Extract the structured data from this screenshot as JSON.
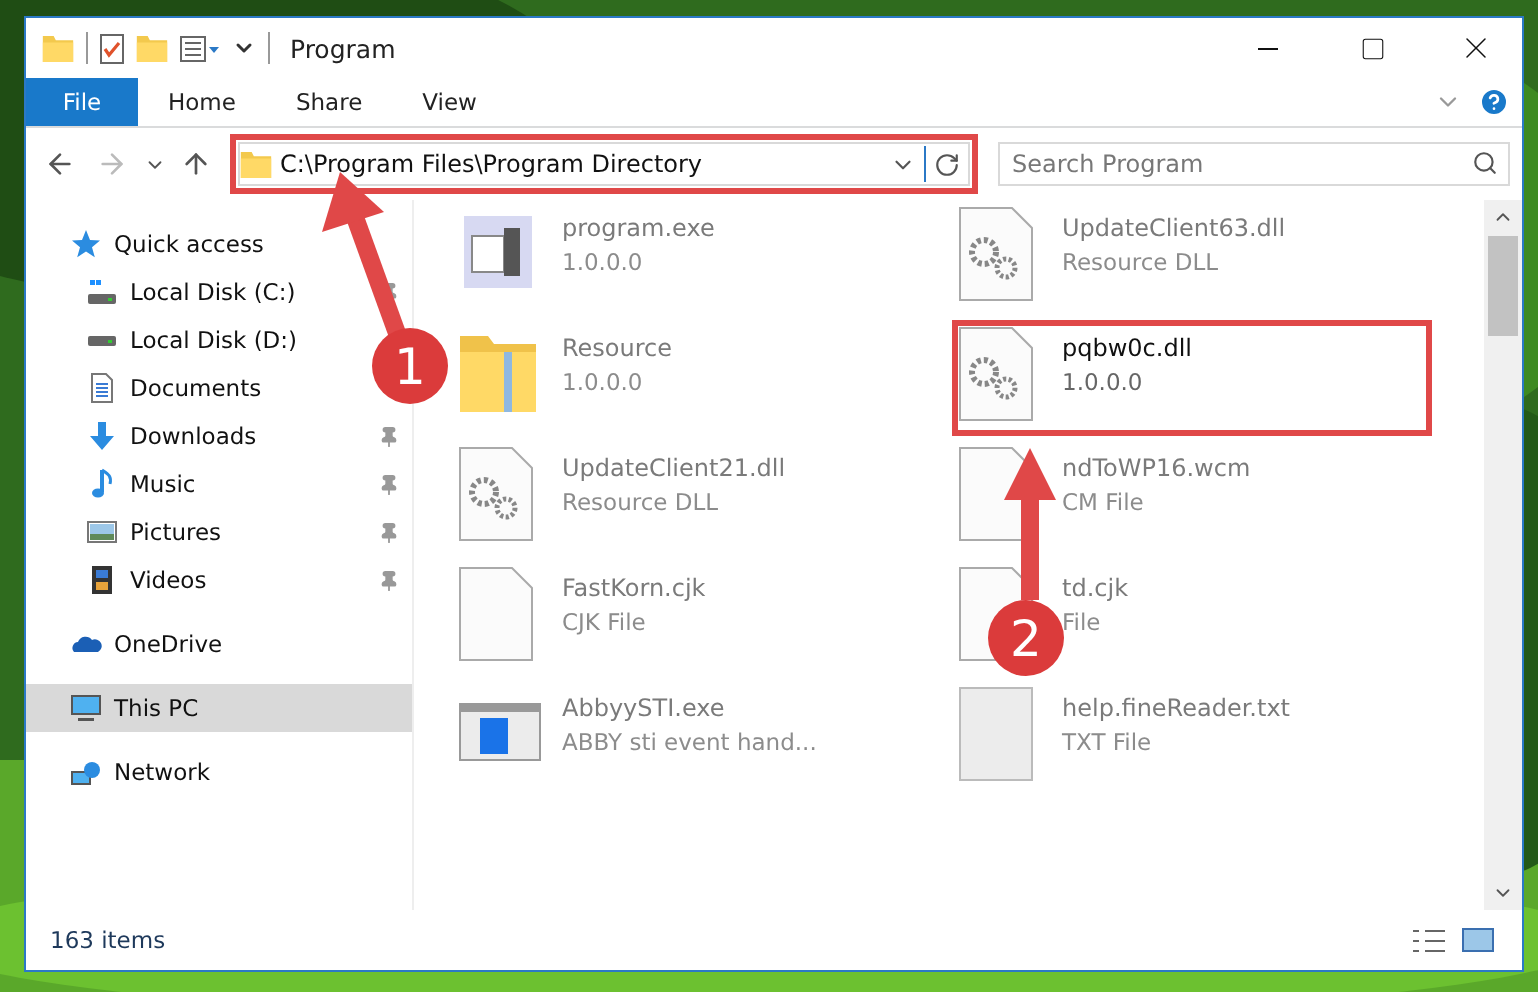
{
  "window": {
    "title": "Program"
  },
  "ribbon_tabs": [
    {
      "label": "File",
      "kind": "menu"
    },
    {
      "label": "Home",
      "kind": "tab"
    },
    {
      "label": "Share",
      "kind": "tab"
    },
    {
      "label": "View",
      "kind": "tab"
    }
  ],
  "address_bar": {
    "path": "C:\\Program Files\\Program Directory",
    "highlighted": true
  },
  "search": {
    "placeholder": "Search Program"
  },
  "sidebar": {
    "items": [
      {
        "label": "Quick access",
        "kind": "star",
        "selected": false,
        "children": [
          {
            "label": "Local Disk (C:)",
            "kind": "system",
            "selected": false,
            "pinned": true
          },
          {
            "label": "Local Disk (D:)",
            "kind": "drive",
            "selected": false,
            "pinned": false
          },
          {
            "label": "Documents",
            "kind": "document",
            "selected": false,
            "pinned": false
          },
          {
            "label": "Downloads",
            "kind": "download",
            "selected": false,
            "pinned": true
          },
          {
            "label": "Music",
            "kind": "music",
            "selected": false,
            "pinned": true
          },
          {
            "label": "Pictures",
            "kind": "pictures",
            "selected": false,
            "pinned": true
          },
          {
            "label": "Videos",
            "kind": "videos",
            "selected": false,
            "pinned": true
          }
        ]
      },
      {
        "label": "OneDrive",
        "kind": "cloud",
        "selected": false
      },
      {
        "label": "This PC",
        "kind": "computer",
        "selected": true
      },
      {
        "label": "Network",
        "kind": "network",
        "selected": false
      }
    ]
  },
  "files": [
    {
      "name": "program.exe",
      "detail": "1.0.0.0",
      "kind": "app",
      "blurred": true,
      "highlighted": false
    },
    {
      "name": "UpdateClient63.dll",
      "detail": "Resource DLL",
      "kind": "dll",
      "blurred": true,
      "highlighted": false
    },
    {
      "name": "Resource",
      "detail": "1.0.0.0",
      "kind": "folder",
      "blurred": true,
      "highlighted": false
    },
    {
      "name": "pqbw0c.dll",
      "detail": "1.0.0.0",
      "kind": "dll",
      "blurred": false,
      "highlighted": true
    },
    {
      "name": "UpdateClient21.dll",
      "detail": "Resource DLL",
      "kind": "dll",
      "blurred": true,
      "highlighted": false
    },
    {
      "name": "ndToWP16.wcm",
      "detail": "CM File",
      "kind": "blank",
      "blurred": true,
      "highlighted": false
    },
    {
      "name": "FastKorn.cjk",
      "detail": "CJK File",
      "kind": "blank",
      "blurred": true,
      "highlighted": false
    },
    {
      "name": "td.cjk",
      "detail": "File",
      "kind": "blank",
      "blurred": true,
      "highlighted": false
    },
    {
      "name": "AbbyySTI.exe",
      "detail": "ABBY sti event hand...",
      "kind": "window",
      "blurred": true,
      "highlighted": false
    },
    {
      "name": "help.fineReader.txt",
      "detail": "TXT File",
      "kind": "text",
      "blurred": true,
      "highlighted": false
    }
  ],
  "status_bar": {
    "item_count": "163 items"
  },
  "annotations": [
    {
      "number": "1"
    },
    {
      "number": "2"
    }
  ]
}
